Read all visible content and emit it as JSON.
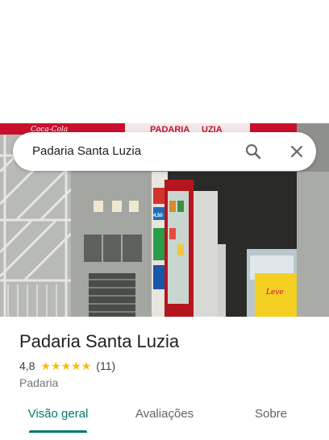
{
  "search": {
    "query": "Padaria Santa Luzia"
  },
  "icons": {
    "search": "search-icon",
    "close": "close-icon",
    "star": "star-icon"
  },
  "photo": {
    "sign_top_left": "Coca-Cola",
    "sign_top_center": "PADARIA",
    "sign_top_right": "UZIA",
    "price_tag": "4,50",
    "bin_text": "Leve"
  },
  "place": {
    "title": "Padaria Santa Luzia",
    "rating": "4,8",
    "stars": 5,
    "review_count": "(11)",
    "category": "Padaria"
  },
  "tabs": [
    {
      "label": "Visão geral",
      "active": true
    },
    {
      "label": "Avaliações",
      "active": false
    },
    {
      "label": "Sobre",
      "active": false
    }
  ],
  "colors": {
    "accent": "#00796b",
    "star": "#fbbc04",
    "text": "#202124",
    "muted": "#70757a"
  }
}
